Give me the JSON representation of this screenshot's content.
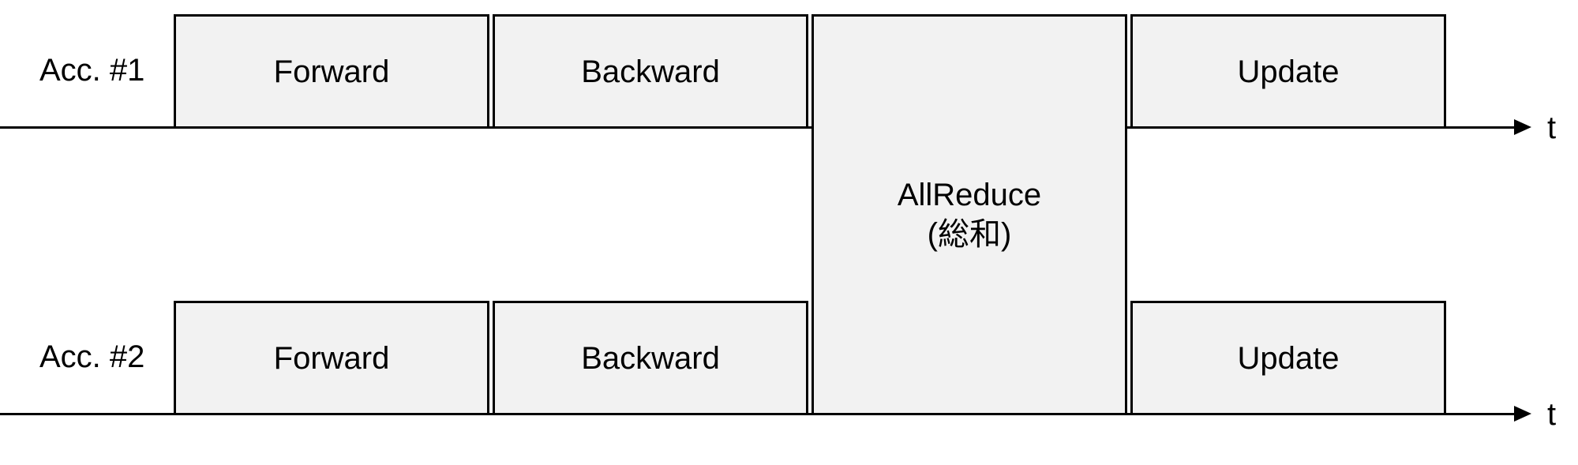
{
  "rows": {
    "r1_label": "Acc. #1",
    "r2_label": "Acc. #2"
  },
  "stages": {
    "forward": "Forward",
    "backward": "Backward",
    "allreduce_line1": "AllReduce",
    "allreduce_line2": "(総和)",
    "update": "Update"
  },
  "axis": {
    "t": "t"
  }
}
